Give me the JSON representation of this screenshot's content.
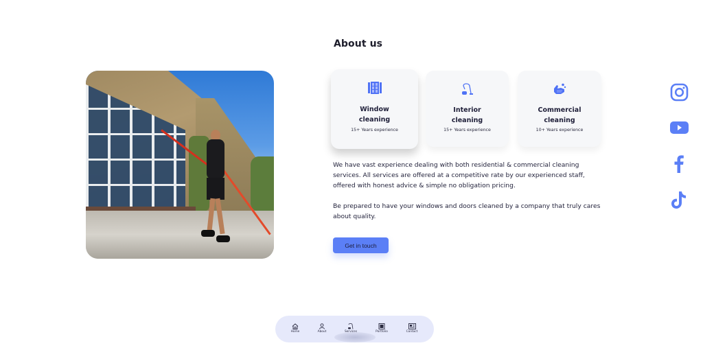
{
  "section": {
    "title": "About us"
  },
  "hero_image": {
    "alt": "Window cleaner using water-fed pole on a brick house"
  },
  "services": [
    {
      "icon": "window-icon",
      "title_line1": "Window",
      "title_line2": "cleaning",
      "experience": "15+ Years experience"
    },
    {
      "icon": "vacuum-cleaner-icon",
      "title_line1": "Interior",
      "title_line2": "cleaning",
      "experience": "15+ Years experience"
    },
    {
      "icon": "hand-washing-icon",
      "title_line1": "Commercial",
      "title_line2": "cleaning",
      "experience": "10+ Years experience"
    }
  ],
  "description": {
    "paragraph1": "We have vast experience dealing with both residential & commercial cleaning services. All services are offered at a competitive rate by our experienced staff, offered with honest advice & simple no obligation pricing.",
    "paragraph2": "Be prepared to have your windows and doors cleaned by a company that truly cares about quality."
  },
  "cta": {
    "label": "Get in touch"
  },
  "social": [
    {
      "name": "instagram-icon"
    },
    {
      "name": "youtube-icon"
    },
    {
      "name": "facebook-icon"
    },
    {
      "name": "tiktok-icon"
    }
  ],
  "bottom_nav": {
    "items": [
      {
        "label": "Home",
        "icon": "home-icon"
      },
      {
        "label": "About",
        "icon": "user-icon"
      },
      {
        "label": "Services",
        "icon": "vacuum-cleaner-icon"
      },
      {
        "label": "Portfolio",
        "icon": "image-icon"
      },
      {
        "label": "Contact",
        "icon": "contact-card-icon"
      }
    ],
    "active": "Services"
  },
  "colors": {
    "accent": "#5b7ff6",
    "icon_blue": "#4f72f5",
    "nav_bg": "#e6e9fb",
    "card_bg": "#f6f7f9"
  }
}
